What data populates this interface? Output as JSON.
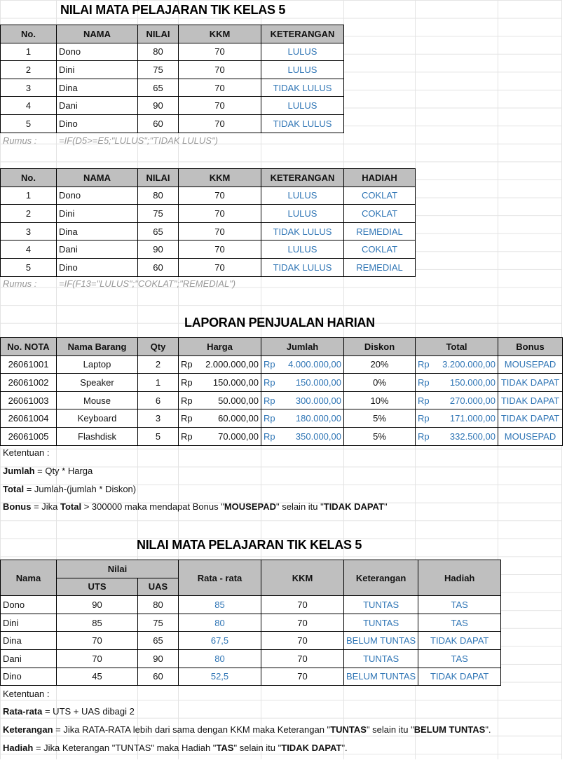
{
  "section1": {
    "title": "NILAI MATA PELAJARAN TIK KELAS 5",
    "headers": [
      "No.",
      "NAMA",
      "NILAI",
      "KKM",
      "KETERANGAN"
    ],
    "rows": [
      [
        "1",
        "Dono",
        "80",
        "70",
        "LULUS"
      ],
      [
        "2",
        "Dini",
        "75",
        "70",
        "LULUS"
      ],
      [
        "3",
        "Dina",
        "65",
        "70",
        "TIDAK LULUS"
      ],
      [
        "4",
        "Dani",
        "90",
        "70",
        "LULUS"
      ],
      [
        "5",
        "Dino",
        "60",
        "70",
        "TIDAK LULUS"
      ]
    ],
    "rumus_label": "Rumus :",
    "rumus": "=IF(D5>=E5;\"LULUS\";\"TIDAK LULUS\")"
  },
  "section2": {
    "headers": [
      "No.",
      "NAMA",
      "NILAI",
      "KKM",
      "KETERANGAN",
      "HADIAH"
    ],
    "rows": [
      [
        "1",
        "Dono",
        "80",
        "70",
        "LULUS",
        "COKLAT"
      ],
      [
        "2",
        "Dini",
        "75",
        "70",
        "LULUS",
        "COKLAT"
      ],
      [
        "3",
        "Dina",
        "65",
        "70",
        "TIDAK LULUS",
        "REMEDIAL"
      ],
      [
        "4",
        "Dani",
        "90",
        "70",
        "LULUS",
        "COKLAT"
      ],
      [
        "5",
        "Dino",
        "60",
        "70",
        "TIDAK LULUS",
        "REMEDIAL"
      ]
    ],
    "rumus_label": "Rumus :",
    "rumus": "=IF(F13=\"LULUS\";\"COKLAT\";\"REMEDIAL\")"
  },
  "section3": {
    "title": "LAPORAN PENJUALAN HARIAN",
    "headers": [
      "No. NOTA",
      "Nama Barang",
      "Qty",
      "Harga",
      "Jumlah",
      "Diskon",
      "Total",
      "Bonus"
    ],
    "currency": "Rp",
    "rows": [
      [
        "26061001",
        "Laptop",
        "2",
        "2.000.000,00",
        "4.000.000,00",
        "20%",
        "3.200.000,00",
        "MOUSEPAD"
      ],
      [
        "26061002",
        "Speaker",
        "1",
        "150.000,00",
        "150.000,00",
        "0%",
        "150.000,00",
        "TIDAK DAPAT"
      ],
      [
        "26061003",
        "Mouse",
        "6",
        "50.000,00",
        "300.000,00",
        "10%",
        "270.000,00",
        "TIDAK DAPAT"
      ],
      [
        "26061004",
        "Keyboard",
        "3",
        "60.000,00",
        "180.000,00",
        "5%",
        "171.000,00",
        "TIDAK DAPAT"
      ],
      [
        "26061005",
        "Flashdisk",
        "5",
        "70.000,00",
        "350.000,00",
        "5%",
        "332.500,00",
        "MOUSEPAD"
      ]
    ],
    "ketentuan": "Ketentuan :",
    "jumlah_label": "Jumlah",
    "jumlah_text": " = Qty * Harga",
    "total_label": "Total",
    "total_text": " = Jumlah-(jumlah * Diskon)",
    "bonus_label": "Bonus",
    "bonus_text1": " = Jika ",
    "bonus_bold1": "Total",
    "bonus_text2": " > 300000 maka mendapat Bonus \"",
    "bonus_bold2": "MOUSEPAD",
    "bonus_text3": "\" selain itu \"",
    "bonus_bold3": "TIDAK DAPAT",
    "bonus_text4": "\""
  },
  "section4": {
    "title": "NILAI MATA PELAJARAN TIK KELAS 5",
    "h_nama": "Nama",
    "h_nilai": "Nilai",
    "h_uts": "UTS",
    "h_uas": "UAS",
    "h_rata": "Rata - rata",
    "h_kkm": "KKM",
    "h_ket": "Keterangan",
    "h_hadiah": "Hadiah",
    "rows": [
      [
        "Dono",
        "90",
        "80",
        "85",
        "70",
        "TUNTAS",
        "TAS"
      ],
      [
        "Dini",
        "85",
        "75",
        "80",
        "70",
        "TUNTAS",
        "TAS"
      ],
      [
        "Dina",
        "70",
        "65",
        "67,5",
        "70",
        "BELUM TUNTAS",
        "TIDAK DAPAT"
      ],
      [
        "Dani",
        "70",
        "90",
        "80",
        "70",
        "TUNTAS",
        "TAS"
      ],
      [
        "Dino",
        "45",
        "60",
        "52,5",
        "70",
        "BELUM TUNTAS",
        "TIDAK DAPAT"
      ]
    ],
    "ketentuan": "Ketentuan :",
    "rata_label": "Rata-rata",
    "rata_text": " = UTS + UAS dibagi 2",
    "ket_label": "Keterangan",
    "ket_text1": " = Jika RATA-RATA lebih dari sama dengan KKM maka Keterangan \"",
    "ket_bold1": "TUNTAS",
    "ket_text2": "\" selain itu \"",
    "ket_bold2": "BELUM TUNTAS",
    "ket_text3": "\".",
    "had_label": "Hadiah",
    "had_text1": " = Jika Keterangan \"TUNTAS\" maka Hadiah \"",
    "had_bold1": "TAS",
    "had_text2": "\" selain itu \"",
    "had_bold2": "TIDAK DAPAT",
    "had_text3": "\"."
  }
}
